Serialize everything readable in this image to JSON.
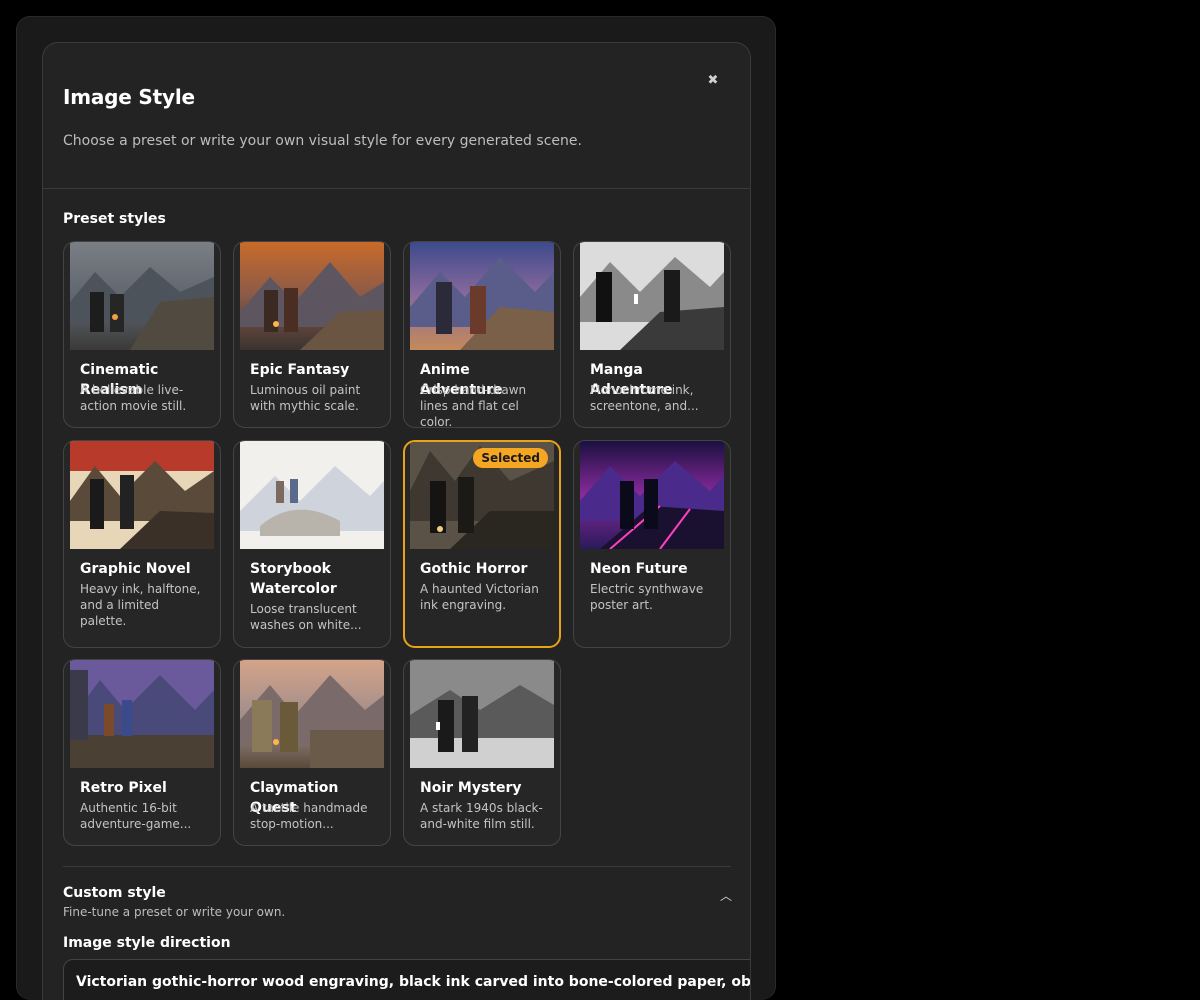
{
  "dialog": {
    "title": "Image Style",
    "subtitle": "Choose a preset or write your own visual style for every generated scene.",
    "close_icon": "close-icon",
    "section_label": "Preset styles",
    "accent_color": "#f5a623"
  },
  "presets": [
    {
      "name": "Cinematic Realism",
      "desc": "A believable live-action movie still.",
      "selected": false
    },
    {
      "name": "Epic Fantasy",
      "desc": "Luminous oil paint with mythic scale.",
      "selected": false
    },
    {
      "name": "Anime Adventure",
      "desc": "Crisp hand-drawn lines and flat cel color.",
      "selected": false
    },
    {
      "name": "Manga Adventure",
      "desc": "Monochrome ink, screentone, and...",
      "selected": false
    },
    {
      "name": "Graphic Novel",
      "desc": "Heavy ink, halftone, and a limited palette.",
      "selected": false
    },
    {
      "name": "Storybook Watercolor",
      "desc": "Loose translucent washes on white...",
      "selected": false
    },
    {
      "name": "Gothic Horror",
      "desc": "A haunted Victorian ink engraving.",
      "selected": true,
      "badge": "Selected"
    },
    {
      "name": "Neon Future",
      "desc": "Electric synthwave poster art.",
      "selected": false
    },
    {
      "name": "Retro Pixel",
      "desc": "Authentic 16-bit adventure-game...",
      "selected": false
    },
    {
      "name": "Claymation Quest",
      "desc": "A tactile handmade stop-motion...",
      "selected": false
    },
    {
      "name": "Noir Mystery",
      "desc": "A stark 1940s black-and-white film still.",
      "selected": false
    }
  ],
  "custom": {
    "title": "Custom style",
    "subtitle": "Fine-tune a preset or write your own.",
    "chevron_icon": "chevron-up-icon",
    "field_label": "Image style direction",
    "value": "Victorian gothic-horror wood engraving, black ink carved into bone-colored paper, obsessive"
  }
}
